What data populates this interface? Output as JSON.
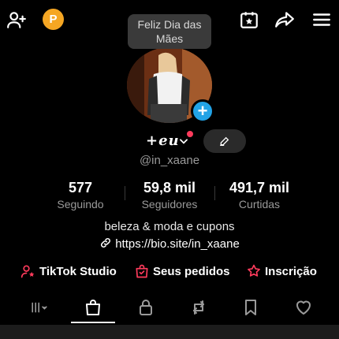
{
  "header": {
    "icons": [
      "add-user-icon",
      "p-badge",
      "calendar-star-icon",
      "share-icon",
      "menu-icon"
    ],
    "badge_letter": "P"
  },
  "tooltip": {
    "line1": "Feliz Dia das",
    "line2": "Mães"
  },
  "profile": {
    "display_name": "+eu",
    "username": "@in_xaane",
    "add_button": "+",
    "accent_color": "#22a3e6",
    "notification_dot_color": "#ff3b5c"
  },
  "stats": [
    {
      "value": "577",
      "label": "Seguindo"
    },
    {
      "value": "59,8 mil",
      "label": "Seguidores"
    },
    {
      "value": "491,7 mil",
      "label": "Curtidas"
    }
  ],
  "bio": "beleza & moda e cupons",
  "link": "https://bio.site/in_xaane",
  "tools": [
    {
      "label": "TikTok Studio",
      "icon": "person-star-icon"
    },
    {
      "label": "Seus pedidos",
      "icon": "order-bag-icon"
    },
    {
      "label": "Inscrição",
      "icon": "subscription-icon"
    }
  ],
  "tool_icon_color": "#ff3b5c",
  "tabs": [
    "videos-grid-icon",
    "shop-bag-icon",
    "lock-icon",
    "repost-icon",
    "bookmark-icon",
    "heart-icon"
  ],
  "active_tab": "shop-bag-icon"
}
